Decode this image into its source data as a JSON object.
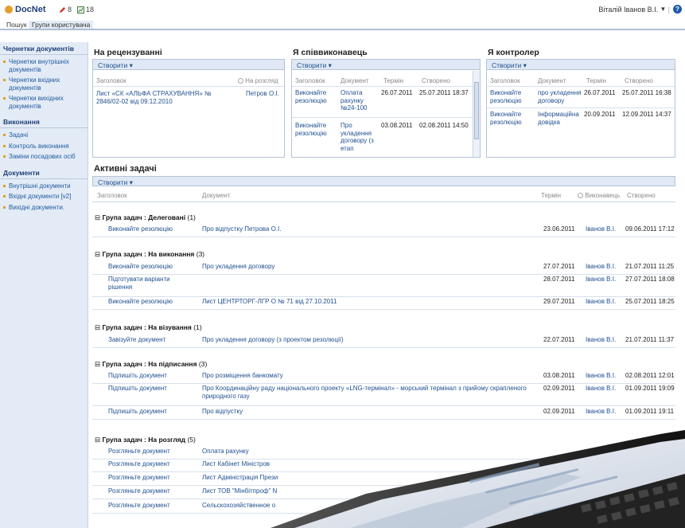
{
  "app": {
    "name": "DocNet",
    "count1": "8",
    "count2": "18",
    "user": "Віталій Іванов В.І."
  },
  "nav": {
    "tab1": "Пошук",
    "tab2": "Групи користувача"
  },
  "sidebar": {
    "sec1": "Чернетки документів",
    "items1": [
      "Чернетки внутрішніх документів",
      "Чернетки вхідних документів",
      "Чернетки вихідних документів"
    ],
    "sec2": "Виконання",
    "items2": [
      "Задачі",
      "Контроль виконання",
      "Заміни посадових осіб"
    ],
    "sec3": "Документи",
    "items3": [
      "Внутрішні документи",
      "Вхідні документи [v2]",
      "Вихідні документи."
    ]
  },
  "review": {
    "title": "На рецензуванні",
    "create": "Створити",
    "h1": "Заголовок",
    "h2": "На розгляд",
    "r1c1": "Лист «СК «АЛЬФА СТРАХУВАННЯ» № 2846/02-02 від 09.12.2010",
    "r1c2": "Петров О.І."
  },
  "coexec": {
    "title": "Я співвиконавець",
    "create": "Створити",
    "h1": "Заголовок",
    "h2": "Документ",
    "h3": "Термін",
    "h4": "Створено",
    "r1": [
      "Виконайте резолюцію",
      "Оплата рахунку №24-100",
      "26.07.2011",
      "25.07.2011 18:37"
    ],
    "r2": [
      "Виконайте резолюцію",
      "Про укладення договору (з етап",
      "03.08.2011",
      "02.08.2011 14:50"
    ]
  },
  "control": {
    "title": "Я контролер",
    "create": "Створити",
    "h1": "Заголовок",
    "h2": "Документ",
    "h3": "Термін",
    "h4": "Створено",
    "r1": [
      "Виконайте резолюцію",
      "про укладення договору",
      "26.07.2011",
      "25.07.2011 16:38"
    ],
    "r2": [
      "Виконайте резолюцію",
      "Інформаційна довідка",
      "20.09.2011",
      "12.09.2011 14:37"
    ]
  },
  "tasks": {
    "title": "Активні задачі",
    "create": "Створити",
    "h1": "Заголовок",
    "h2": "Документ",
    "h3": "Термін",
    "h4": "Виконавець",
    "h5": "Створено",
    "gprefix": "Група задач :",
    "g1": {
      "name": "Делеговані",
      "count": "(1)"
    },
    "g2": {
      "name": "На виконання",
      "count": "(3)"
    },
    "g3": {
      "name": "На візування",
      "count": "(1)"
    },
    "g4": {
      "name": "На підписання",
      "count": "(3)"
    },
    "g5": {
      "name": "На розгляд",
      "count": "(5)"
    },
    "rows": [
      [
        "Виконайте резолюцію",
        "Про відпустку Петрова О.І.",
        "23.06.2011",
        "Іванов В.І.",
        "09.06.2011 17:12"
      ],
      [
        "Виконайте резолюцію",
        "Про укладення договору",
        "27.07.2011",
        "Іванов В.І.",
        "21.07.2011 11:25"
      ],
      [
        "Підготувати варіанти рішення",
        "",
        "28.07.2011",
        "Іванов В.І.",
        "27.07.2011 18:08"
      ],
      [
        "Виконайте резолюцію",
        "Лист ЦЕНТРТОРГ-ЛГР О № 71 від 27.10.2011",
        "29.07.2011",
        "Іванов В.І.",
        "25.07.2011 18:25"
      ],
      [
        "Завізуйте документ",
        "Про укладення договору (з проектом резолюції)",
        "22.07.2011",
        "Іванов В.І.",
        "21.07.2011 11:37"
      ],
      [
        "Підпишіть документ",
        "Про розміщення банкомату",
        "03.08.2011",
        "Іванов В.І.",
        "02.08.2011 12:01"
      ],
      [
        "Підпишіть документ",
        "Про Координаційну раду національного проекту «LNG-термінал» - морський термінал з прийому скрапленого природного газу",
        "02.09.2011",
        "Іванов В.І.",
        "01.09.2011 19:09"
      ],
      [
        "Підпишіть документ",
        "Про відпустку",
        "02.09.2011",
        "Іванов В.І.",
        "01.09.2011 19:11"
      ],
      [
        "Розгляньте документ",
        "Оплата рахунку",
        "",
        "",
        ""
      ],
      [
        "Розгляньте документ",
        "Лист Кабінет Міністров",
        "",
        "",
        ""
      ],
      [
        "Розгляньте документ",
        "Лист Адміністрація Прези",
        "",
        "",
        ""
      ],
      [
        "Розгляньте документ",
        "Лист ТОВ \"Мінбітпроф\" N",
        "",
        "",
        ""
      ],
      [
        "Розгляньте документ",
        "Сельскохозяйственное о",
        "",
        "",
        ""
      ]
    ]
  }
}
